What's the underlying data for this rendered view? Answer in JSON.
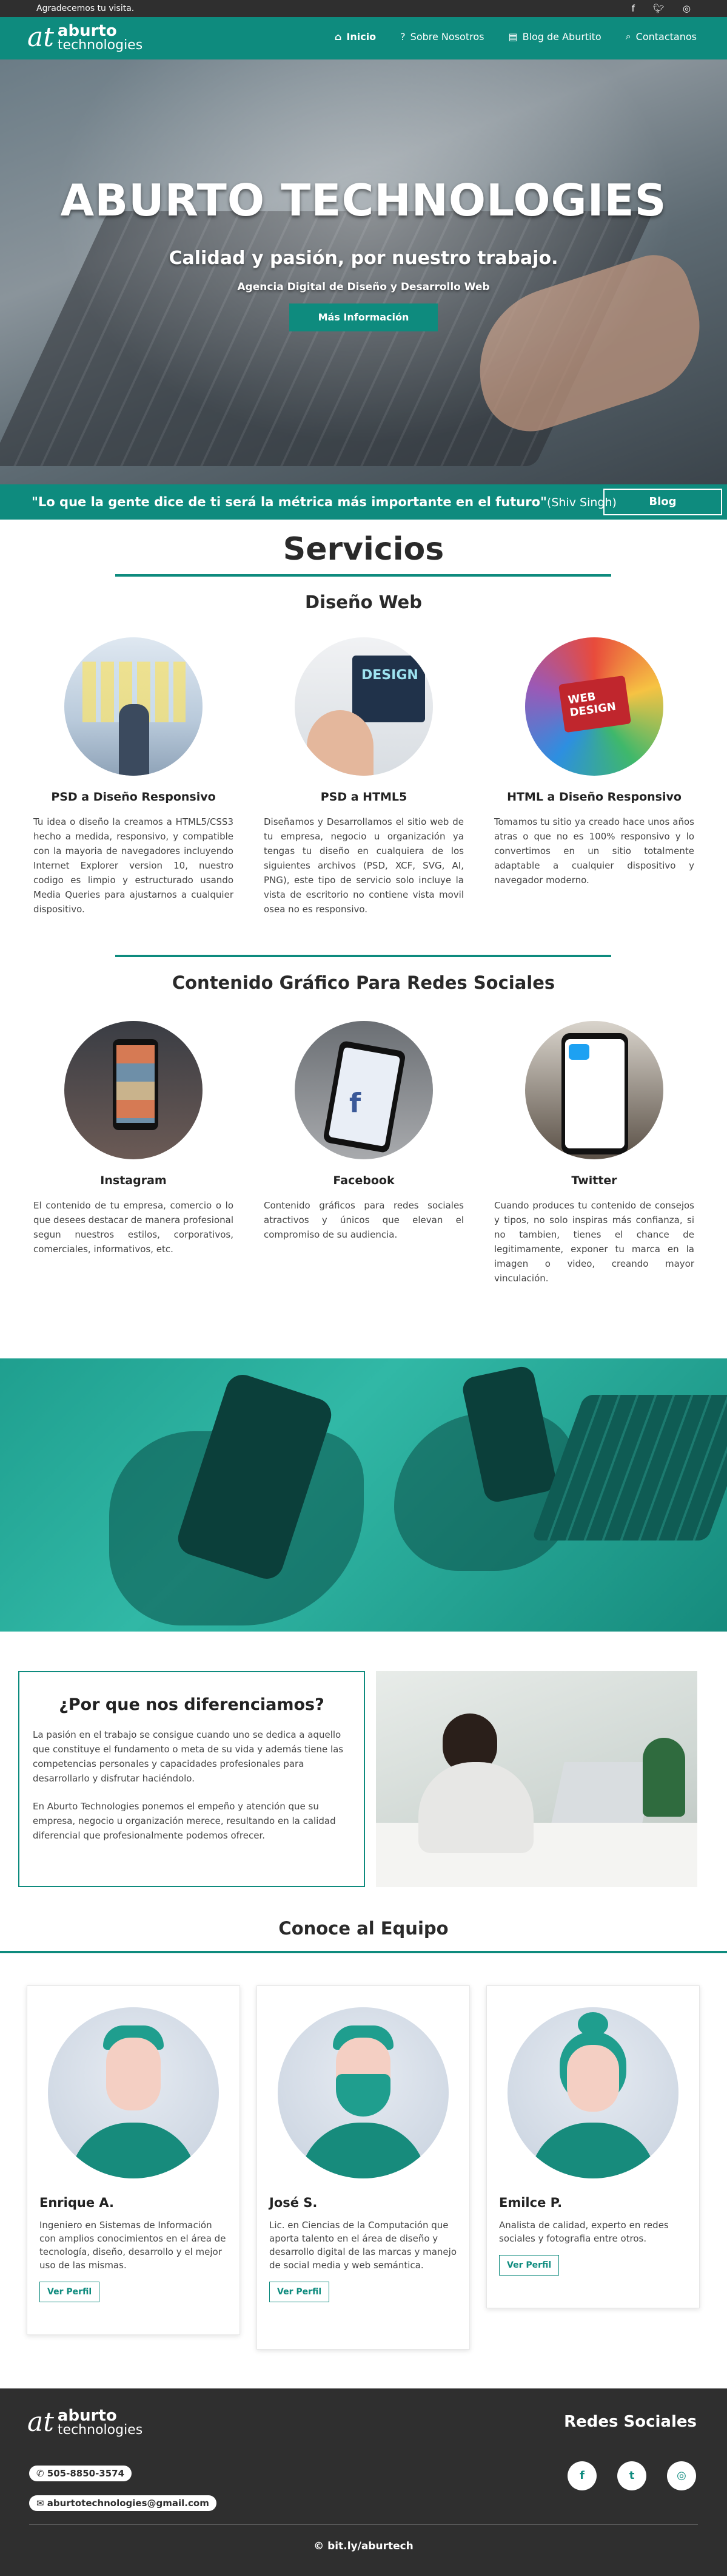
{
  "topbar": {
    "greeting": "Agradecemos tu visita.",
    "social_icons": [
      "facebook-icon",
      "twitter-icon",
      "instagram-icon"
    ]
  },
  "brand": {
    "mark": "at",
    "line1": "aburto",
    "line2": "technologies"
  },
  "nav": {
    "items": [
      {
        "label": "Inicio",
        "icon": "home-icon"
      },
      {
        "label": "Sobre Nosotros",
        "icon": "question-icon"
      },
      {
        "label": "Blog de Aburtito",
        "icon": "book-icon"
      },
      {
        "label": "Contactanos",
        "icon": "search-icon"
      }
    ]
  },
  "hero": {
    "title": "ABURTO TECHNOLOGIES",
    "tagline": "Calidad y pasión, por nuestro trabajo.",
    "subtitle": "Agencia Digital de Diseño y Desarrollo Web",
    "cta": "Más Información"
  },
  "quote": {
    "text": "\"Lo que la gente dice de ti será la métrica más importante en el futuro\"",
    "author": "(Shiv Singh)",
    "button": "Blog"
  },
  "servicios": {
    "title": "Servicios",
    "web": {
      "heading": "Diseño Web",
      "items": [
        {
          "title": "PSD a Diseño Responsivo",
          "text": "Tu idea o diseño la creamos a HTML5/CSS3 hecho a medida, responsivo, y compatible con la mayoria de navegadores incluyendo Internet Explorer version 10, nuestro codigo es limpio y estructurado usando Media Queries para ajustarnos a cualquier dispositivo."
        },
        {
          "title": "PSD a HTML5",
          "text": "Diseñamos y Desarrollamos el sitio web de tu empresa, negocio u organización ya tengas tu diseño en cualquiera de los siguientes archivos (PSD, XCF, SVG, AI, PNG), este tipo de servicio solo incluye la vista de escritorio no contiene vista movil osea no es responsivo."
        },
        {
          "title": "HTML a Diseño Responsivo",
          "text": "Tomamos tu sitio ya creado hace unos años atras o que no es 100% responsivo y lo convertimos en un sitio totalmente adaptable a cualquier dispositivo y navegador moderno."
        }
      ]
    },
    "social": {
      "heading": "Contenido Gráfico Para Redes Sociales",
      "items": [
        {
          "title": "Instagram",
          "text": "El contenido de tu empresa, comercio o lo que desees destacar de manera profesional segun nuestros estilos, corporativos, comerciales, informativos, etc."
        },
        {
          "title": "Facebook",
          "text": "Contenido gráficos para redes sociales atractivos y únicos que elevan el compromiso de su audiencia."
        },
        {
          "title": "Twitter",
          "text": "Cuando produces tu contenido de consejos y tipos, no solo inspiras más confianza, si no tambien, tienes el chance de legitimamente, exponer tu marca en la imagen o video, creando mayor vinculación."
        }
      ]
    }
  },
  "diff": {
    "title": "¿Por que nos diferenciamos?",
    "p1": "La pasión en el trabajo se consigue cuando uno se dedica a aquello que constituye el fundamento o meta de su vida y además tiene las competencias personales y capacidades profesionales para desarrollarlo y disfrutar haciéndolo.",
    "p2": "En Aburto Technologies ponemos el empeño y atención que su empresa, negocio u organización merece, resultando en la calidad diferencial que profesionalmente podemos ofrecer."
  },
  "team": {
    "title": "Conoce al Equipo",
    "members": [
      {
        "name": "Enrique A.",
        "bio": "Ingeniero en Sistemas de Información con amplios conocimientos en el área de tecnología, diseño, desarrollo y el mejor uso de las mismas.",
        "button": "Ver Perfil"
      },
      {
        "name": "José S.",
        "bio": "Lic. en Ciencias de la Computación que aporta talento en el área de diseño y desarrollo digital de las marcas y manejo de social media y web semántica.",
        "button": "Ver Perfil"
      },
      {
        "name": "Emilce P.",
        "bio": "Analista de calidad, experto en redes sociales y fotografia entre otros.",
        "button": "Ver Perfil"
      }
    ]
  },
  "footer": {
    "redes": "Redes Sociales",
    "phone": "505-8850-3574",
    "email": "aburtotechnologies@gmail.com",
    "url": "© bit.ly/aburtech",
    "social_icons": [
      {
        "name": "facebook-icon",
        "glyph": "f"
      },
      {
        "name": "twitter-icon",
        "glyph": "t"
      },
      {
        "name": "instagram-icon",
        "glyph": "◎"
      }
    ]
  },
  "colors": {
    "accent": "#0e8b7e",
    "dark": "#2f2f2f"
  }
}
